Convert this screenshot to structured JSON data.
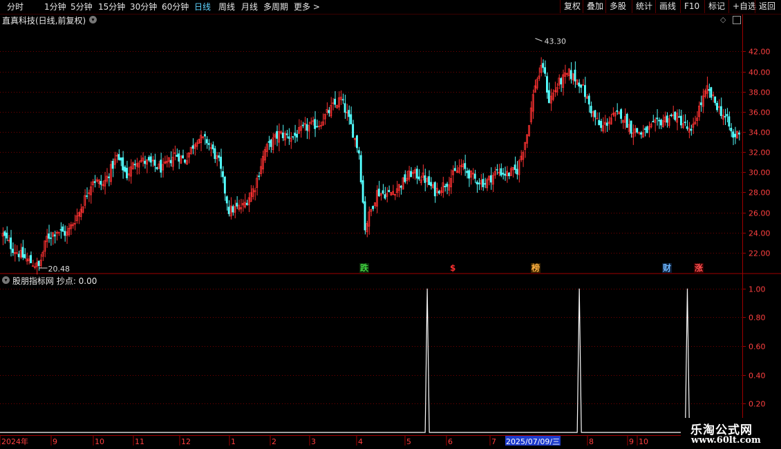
{
  "toolbar": {
    "periods": [
      "分时",
      "1分钟",
      "5分钟",
      "15分钟",
      "30分钟",
      "60分钟",
      "日线",
      "周线",
      "月线",
      "多周期",
      "更多 >"
    ],
    "active_period": "日线",
    "buttons": [
      "复权",
      "叠加",
      "多股",
      "统计",
      "画线",
      "F10",
      "标记",
      "+自选",
      "返回"
    ]
  },
  "main_title": "直真科技(日线,前复权)",
  "indicator_title": "股朋指标网  抄点: 0.00",
  "colors": {
    "up": "#ff3232",
    "down": "#54ffff",
    "grid": "#7a0000",
    "axis": "#a00000",
    "line": "#ffffff",
    "date_highlight": "#1e3ccc"
  },
  "chart_data": [
    {
      "type": "candlestick",
      "title": "直真科技(日线,前复权)",
      "y_ticks": [
        "42.00",
        "40.00",
        "38.00",
        "36.00",
        "34.00",
        "32.00",
        "30.00",
        "28.00",
        "26.00",
        "24.00",
        "22.00"
      ],
      "ylim": [
        20.0,
        44.5
      ],
      "high_label": "43.30",
      "low_label": "20.48",
      "close_path": [
        [
          0,
          23.8
        ],
        [
          5,
          22.4
        ],
        [
          12,
          21.3
        ],
        [
          18,
          20.6
        ],
        [
          22,
          23.5
        ],
        [
          27,
          24.2
        ],
        [
          32,
          23.9
        ],
        [
          38,
          26.0
        ],
        [
          45,
          29.3
        ],
        [
          50,
          28.7
        ],
        [
          57,
          31.5
        ],
        [
          62,
          29.7
        ],
        [
          67,
          31.3
        ],
        [
          73,
          30.9
        ],
        [
          80,
          30.3
        ],
        [
          86,
          31.8
        ],
        [
          91,
          31.2
        ],
        [
          97,
          33.4
        ],
        [
          102,
          33.1
        ],
        [
          108,
          31.0
        ],
        [
          113,
          26.2
        ],
        [
          120,
          26.6
        ],
        [
          126,
          28.6
        ],
        [
          131,
          32.2
        ],
        [
          138,
          33.8
        ],
        [
          145,
          33.5
        ],
        [
          151,
          34.4
        ],
        [
          158,
          34.8
        ],
        [
          164,
          36.3
        ],
        [
          169,
          37.3
        ],
        [
          174,
          34.6
        ],
        [
          178,
          32.0
        ],
        [
          181,
          24.5
        ],
        [
          187,
          28.0
        ],
        [
          193,
          27.8
        ],
        [
          198,
          28.6
        ],
        [
          204,
          29.9
        ],
        [
          210,
          29.5
        ],
        [
          216,
          28.1
        ],
        [
          222,
          29.0
        ],
        [
          229,
          30.6
        ],
        [
          236,
          29.3
        ],
        [
          241,
          28.9
        ],
        [
          247,
          30.1
        ],
        [
          252,
          29.8
        ],
        [
          257,
          30.2
        ],
        [
          262,
          33.8
        ],
        [
          266,
          38.8
        ],
        [
          270,
          40.6
        ],
        [
          273,
          37.1
        ],
        [
          278,
          38.9
        ],
        [
          283,
          39.8
        ],
        [
          289,
          38.8
        ],
        [
          294,
          36.2
        ],
        [
          299,
          34.3
        ],
        [
          304,
          35.4
        ],
        [
          309,
          35.8
        ],
        [
          314,
          34.3
        ],
        [
          320,
          33.8
        ],
        [
          325,
          34.6
        ],
        [
          331,
          35.3
        ],
        [
          336,
          35.6
        ],
        [
          340,
          34.9
        ],
        [
          344,
          33.8
        ],
        [
          348,
          36.4
        ],
        [
          352,
          38.2
        ],
        [
          357,
          36.6
        ],
        [
          362,
          35.1
        ],
        [
          365,
          33.4
        ],
        [
          368,
          34.1
        ]
      ],
      "indicator": {
        "name": "抄点",
        "y_ticks": [
          "1.00",
          "0.80",
          "0.60",
          "0.40",
          "0.20"
        ],
        "ylim": [
          0,
          1.1
        ],
        "signals_at_bar": [
          212,
          288,
          342
        ]
      },
      "x_ticks": [
        "2024年",
        "9",
        "10",
        "11",
        "12",
        "1",
        "2",
        "3",
        "4",
        "5",
        "6",
        "7",
        "2025/07/09/三",
        "8",
        "9",
        "10"
      ],
      "event_tags": [
        {
          "text": "跌",
          "color": "#40d040",
          "bg": "#0a2a0a"
        },
        {
          "text": "$",
          "color": "#ff3030",
          "bg": "#000000"
        },
        {
          "text": "榜",
          "color": "#ffb040",
          "bg": "#3a2400"
        },
        {
          "text": "财",
          "color": "#6fb7ff",
          "bg": "#0a1f3a"
        },
        {
          "text": "涨",
          "color": "#ff5050",
          "bg": "#3a0000"
        }
      ]
    }
  ],
  "watermark": {
    "line1": "乐淘公式网",
    "line2": "www.60lt.com"
  }
}
